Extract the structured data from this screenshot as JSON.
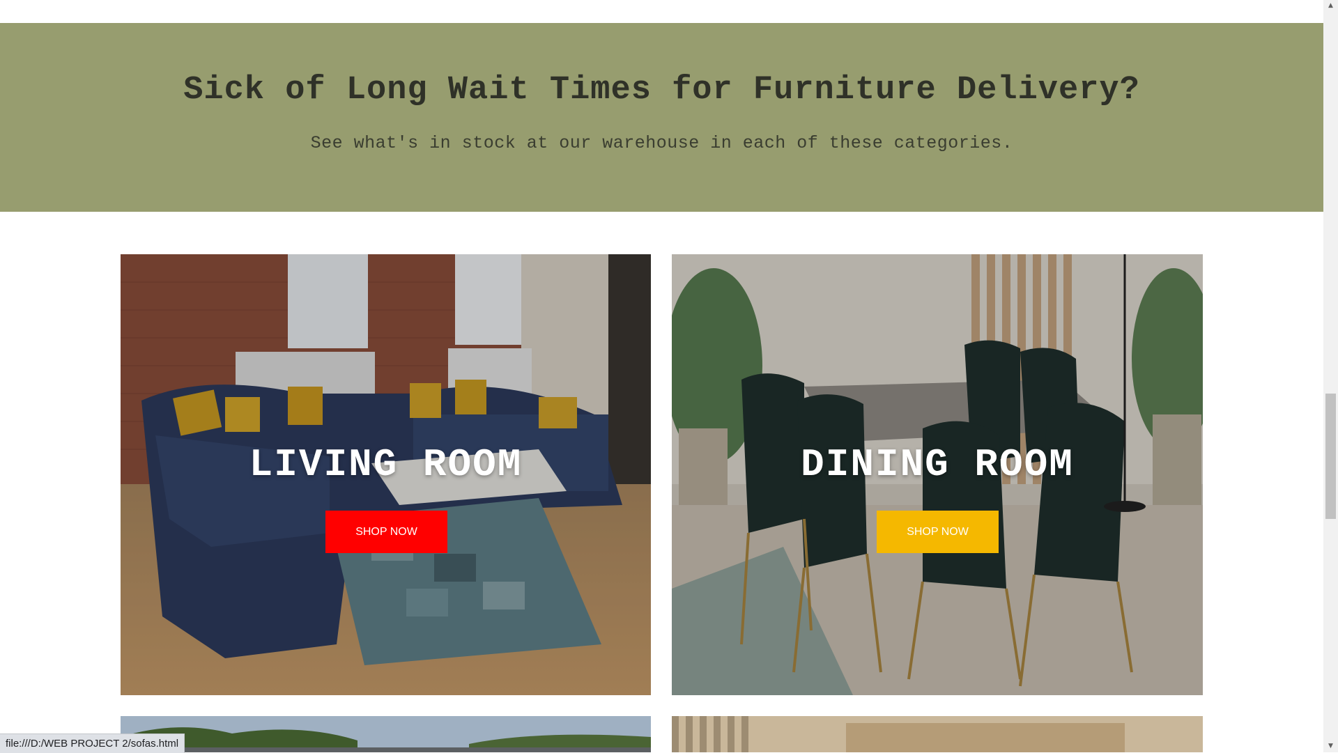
{
  "banner": {
    "heading": "Sick of Long Wait Times for Furniture Delivery?",
    "subheading": "See what's in stock at our warehouse in each of these categories."
  },
  "categories": [
    {
      "title": "LIVING ROOM",
      "button_label": "SHOP NOW",
      "button_color": "#ff0000"
    },
    {
      "title": "DINING ROOM",
      "button_label": "SHOP NOW",
      "button_color": "#f5b800"
    }
  ],
  "colors": {
    "banner_bg": "#979d6f",
    "heading_text": "#2f3128"
  },
  "status_bar": {
    "url": "file:///D:/WEB PROJECT 2/sofas.html"
  },
  "scrollbar": {
    "up_icon": "arrow-up-icon",
    "down_icon": "arrow-down-icon"
  }
}
